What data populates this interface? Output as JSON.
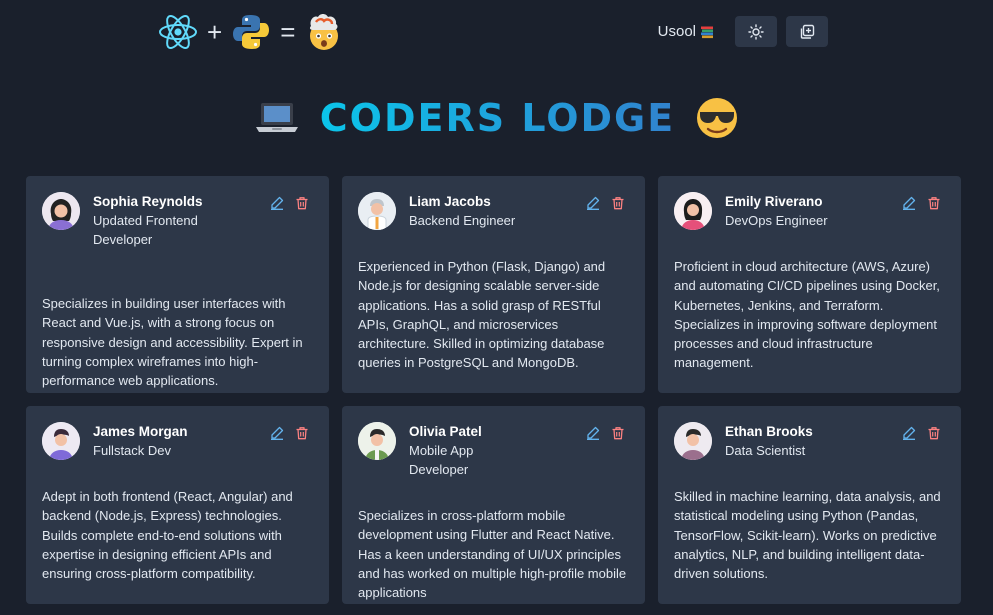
{
  "header": {
    "username": "Usool",
    "logo": {
      "plus": "+",
      "equals": "="
    },
    "icons": [
      "react-icon",
      "python-icon",
      "exploding-head-icon",
      "books-icon",
      "sun-icon",
      "add-icon"
    ]
  },
  "title": {
    "text": "CODERS LODGE",
    "gradient": [
      "#0bc5ea",
      "#3182ce"
    ]
  },
  "colors": {
    "bg": "#1a202c",
    "card": "#2d3748",
    "edit": "#63b3ed",
    "delete": "#fc8181"
  },
  "cards": [
    {
      "name": "Sophia Reynolds",
      "role": "Updated Frontend Developer",
      "description": "Specializes in building user interfaces with React and Vue.js, with a strong focus on responsive design and accessibility. Expert in turning complex wireframes into high-performance web applications."
    },
    {
      "name": "Liam Jacobs",
      "role": "Backend Engineer",
      "description": "Experienced in Python (Flask, Django) and Node.js for designing scalable server-side applications. Has a solid grasp of RESTful APIs, GraphQL, and microservices architecture. Skilled in optimizing database queries in PostgreSQL and MongoDB."
    },
    {
      "name": "Emily Riverano",
      "role": "DevOps Engineer",
      "description": "Proficient in cloud architecture (AWS, Azure) and automating CI/CD pipelines using Docker, Kubernetes, Jenkins, and Terraform. Specializes in improving software deployment processes and cloud infrastructure management."
    },
    {
      "name": "James Morgan",
      "role": "Fullstack Dev",
      "description": "Adept in both frontend (React, Angular) and backend (Node.js, Express) technologies. Builds complete end-to-end solutions with expertise in designing efficient APIs and ensuring cross-platform compatibility."
    },
    {
      "name": "Olivia Patel",
      "role": "Mobile App Developer",
      "description": "Specializes in cross-platform mobile development using Flutter and React Native. Has a keen understanding of UI/UX principles and has worked on multiple high-profile mobile applications"
    },
    {
      "name": "Ethan Brooks",
      "role": "Data Scientist",
      "description": "Skilled in machine learning, data analysis, and statistical modeling using Python (Pandas, TensorFlow, Scikit-learn). Works on predictive analytics, NLP, and building intelligent data-driven solutions."
    }
  ]
}
